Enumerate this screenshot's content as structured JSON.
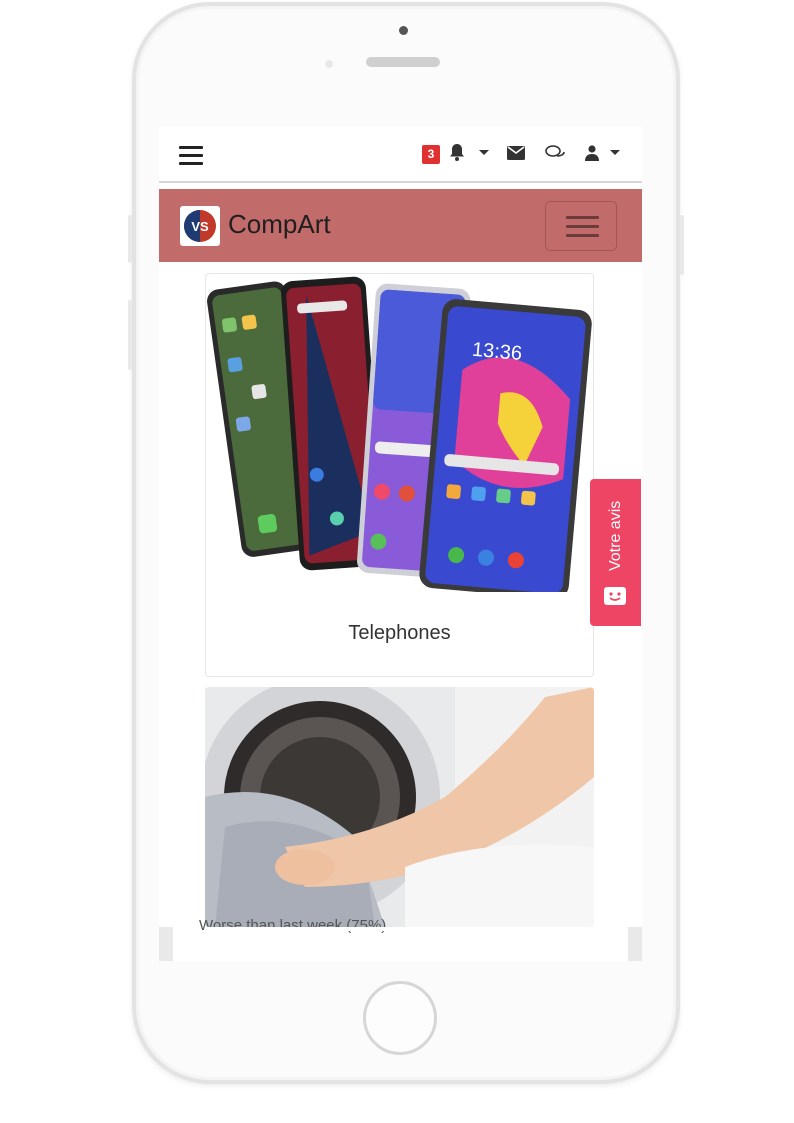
{
  "topbar": {
    "notification_count": "3",
    "icons": [
      "menu-icon",
      "bell-icon",
      "envelope-icon",
      "chat-icon",
      "user-icon"
    ]
  },
  "brand": {
    "logo_text": "VS",
    "name": "CompArt"
  },
  "cards": [
    {
      "title": "Telephones"
    },
    {
      "title": ""
    }
  ],
  "footer_text": "Worse than last week (75%)",
  "feedback": {
    "label": "Votre avis"
  },
  "colors": {
    "brandbar": "#c26b6b",
    "badge": "#e03131",
    "feedback": "#ef4565"
  }
}
